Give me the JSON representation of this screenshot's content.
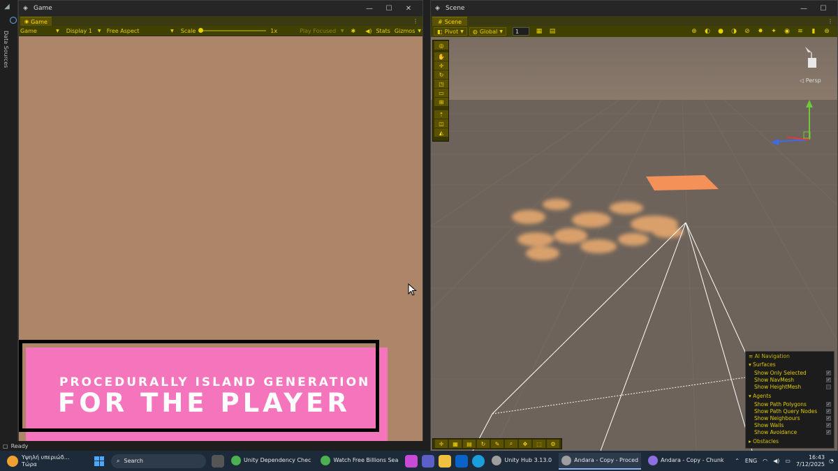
{
  "game": {
    "title": "Game",
    "tab": "Game",
    "toolbar": {
      "mode": "Game",
      "display": "Display 1",
      "aspect": "Free Aspect",
      "scale_label": "Scale",
      "scale_value": "1x",
      "play_mode": "Play Focused",
      "stats": "Stats",
      "gizmos": "Gizmos"
    },
    "view_color": "#ad8568",
    "banner": {
      "line1": "PROCEDURALLY ISLAND GENERATION",
      "line2": "FOR THE PLAYER",
      "color": "#f575bd"
    }
  },
  "vs": {
    "vertical_label": "Data Sources"
  },
  "scene": {
    "tab": "Scene",
    "toolbar": {
      "pivot": "Pivot",
      "global": "Global",
      "grid_value": "1"
    },
    "persp": "Persp",
    "ai_navigation": {
      "title": "AI Navigation",
      "surfaces_label": "Surfaces",
      "surfaces": [
        {
          "label": "Show Only Selected",
          "checked": true
        },
        {
          "label": "Show NavMesh",
          "checked": true
        },
        {
          "label": "Show HeightMesh",
          "checked": false
        }
      ],
      "agents_label": "Agents",
      "agents": [
        {
          "label": "Show Path Polygons",
          "checked": true
        },
        {
          "label": "Show Path Query Nodes",
          "checked": true
        },
        {
          "label": "Show Neighbours",
          "checked": true
        },
        {
          "label": "Show Walls",
          "checked": true
        },
        {
          "label": "Show Avoidance",
          "checked": true
        }
      ],
      "obstacles_label": "Obstacles"
    }
  },
  "status": {
    "text": "Ready"
  },
  "taskbar": {
    "weather_line1": "Υψηλή υπεριώδ...",
    "weather_line2": "Τώρα",
    "search_placeholder": "Search",
    "apps": [
      {
        "label": "Unity Dependency Chec",
        "color": "#4caf50"
      },
      {
        "label": "Watch Free Billions Sea",
        "color": "#4caf50"
      },
      {
        "label": "Unity Hub 3.13.0",
        "color": "#9e9e9e"
      },
      {
        "label": "Andara - Copy - Proced",
        "color": "#9e9e9e",
        "active": true
      },
      {
        "label": "Andara - Copy - Chunk",
        "color": "#8e6fe0"
      }
    ],
    "lang": "ENG",
    "time": "16:43",
    "date": "7/12/2025"
  }
}
